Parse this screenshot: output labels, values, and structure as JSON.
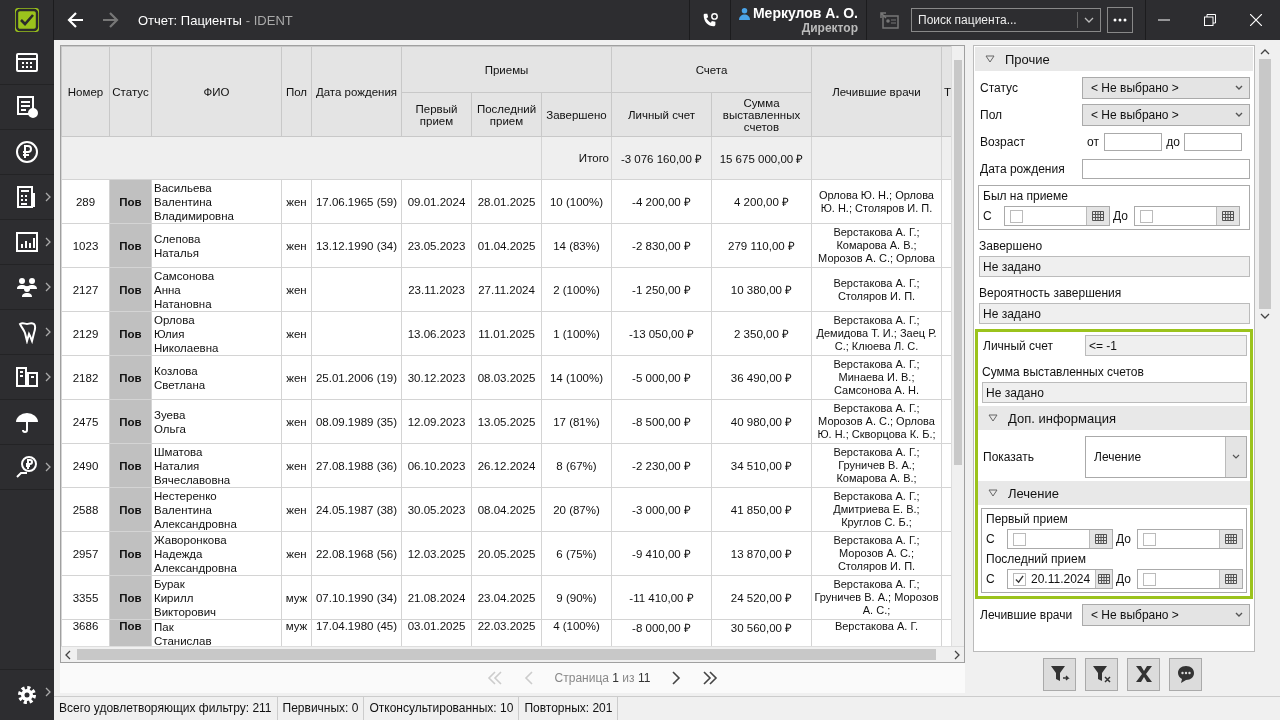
{
  "top_bar": {
    "title": "Отчет: Пациенты",
    "app": "- IDENT",
    "back_disabled": false,
    "forward_disabled": true,
    "user": "Меркулов А. О.",
    "role": "Директор",
    "card_disabled": true,
    "search": {
      "placeholder": "Поиск пациента..."
    }
  },
  "sidebar": {
    "items": [
      {
        "kind": "calendar",
        "submenu": false
      },
      {
        "kind": "document",
        "submenu": false
      },
      {
        "kind": "ruble",
        "submenu": false
      },
      {
        "kind": "calculator",
        "submenu": true
      },
      {
        "kind": "chart",
        "submenu": true
      },
      {
        "kind": "people",
        "submenu": true
      },
      {
        "kind": "tooth",
        "submenu": true
      },
      {
        "kind": "devices",
        "submenu": true
      },
      {
        "kind": "umbrella",
        "submenu": false
      },
      {
        "kind": "ruble-hand",
        "submenu": true
      }
    ],
    "settings": {
      "submenu": true
    }
  },
  "table": {
    "header": [
      {
        "label": "Номер"
      },
      {
        "label": "Статус"
      },
      {
        "label": "ФИО"
      },
      {
        "label": "Пол"
      },
      {
        "label": "Дата рождения"
      },
      {
        "group": "Приемы",
        "columns": [
          "Первый прием",
          "Последний прием",
          "Завершено"
        ]
      },
      {
        "group": "Счета",
        "columns": [
          "Личный счет",
          "Сумма выставленных счетов"
        ]
      },
      {
        "label": "Лечившие врачи"
      },
      {
        "label": "Т"
      }
    ],
    "totals": {
      "label": "Итого",
      "personal": "-3 076 160,00 ₽",
      "invoices": "15 675 000,00 ₽"
    },
    "rows": [
      {
        "number": "289",
        "status": "Пов",
        "name": "Васильева Валентина Владимировна",
        "gender": "жен",
        "birth": "17.06.1965 (59)",
        "first": "09.01.2024",
        "last": "28.01.2025",
        "done": "10 (100%)",
        "personal": "-4 200,00 ₽",
        "invoices": "4 200,00 ₽",
        "doctors": "Орлова Ю. Н.; Орлова Ю. Н.; Столяров И. П."
      },
      {
        "number": "1023",
        "status": "Пов",
        "name": "Слепова Наталья",
        "gender": "жен",
        "birth": "13.12.1990 (34)",
        "first": "23.05.2023",
        "last": "01.04.2025",
        "done": "14 (83%)",
        "personal": "-2 830,00 ₽",
        "invoices": "279 110,00 ₽",
        "doctors": "Верстакова А. Г.; Комарова А. В.; Морозов А. С.; Орлова"
      },
      {
        "number": "2127",
        "status": "Пов",
        "name": "Самсонова Анна Натановна",
        "gender": "жен",
        "birth": "",
        "first": "23.11.2023",
        "last": "27.11.2024",
        "done": "2 (100%)",
        "personal": "-1 250,00 ₽",
        "invoices": "10 380,00 ₽",
        "doctors": "Верстакова А. Г.; Столяров И. П."
      },
      {
        "number": "2129",
        "status": "Пов",
        "name": "Орлова Юлия Николаевна",
        "gender": "жен",
        "birth": "",
        "first": "13.06.2023",
        "last": "11.01.2025",
        "done": "1 (100%)",
        "personal": "-13 050,00 ₽",
        "invoices": "2 350,00 ₽",
        "doctors": "Верстакова А. Г.; Демидова Т. И.; Заец Р. С.; Клюева Л. С."
      },
      {
        "number": "2182",
        "status": "Пов",
        "name": "Козлова Светлана",
        "gender": "жен",
        "birth": "25.01.2006 (19)",
        "first": "30.12.2023",
        "last": "08.03.2025",
        "done": "14 (100%)",
        "personal": "-5 000,00 ₽",
        "invoices": "36 490,00 ₽",
        "doctors": "Верстакова А. Г.; Минаева И. В.; Самсонова А. Н."
      },
      {
        "number": "2475",
        "status": "Пов",
        "name": "Зуева Ольга",
        "gender": "жен",
        "birth": "08.09.1989 (35)",
        "first": "12.09.2023",
        "last": "13.05.2025",
        "done": "17 (81%)",
        "personal": "-8 500,00 ₽",
        "invoices": "40 980,00 ₽",
        "doctors": "Верстакова А. Г.; Морозов А. С.; Орлова Ю. Н.; Скворцова К. Б.;"
      },
      {
        "number": "2490",
        "status": "Пов",
        "name": "Шматова Наталия Вячеславовна",
        "gender": "жен",
        "birth": "27.08.1988 (36)",
        "first": "06.10.2023",
        "last": "26.12.2024",
        "done": "8 (67%)",
        "personal": "-2 230,00 ₽",
        "invoices": "34 510,00 ₽",
        "doctors": "Верстакова А. Г.; Груничев В. А.; Комарова А. В.;"
      },
      {
        "number": "2588",
        "status": "Пов",
        "name": "Нестеренко Валентина Александровна",
        "gender": "жен",
        "birth": "24.05.1987 (38)",
        "first": "30.05.2023",
        "last": "08.04.2025",
        "done": "20 (87%)",
        "personal": "-3 000,00 ₽",
        "invoices": "41 850,00 ₽",
        "doctors": "Верстакова А. Г.; Дмитриева Е. В.; Круглов С. Б.;"
      },
      {
        "number": "2957",
        "status": "Пов",
        "name": "Жаворонкова Надежда Александровна",
        "gender": "жен",
        "birth": "22.08.1968 (56)",
        "first": "12.03.2025",
        "last": "20.05.2025",
        "done": "6 (75%)",
        "personal": "-9 410,00 ₽",
        "invoices": "13 870,00 ₽",
        "doctors": "Верстакова А. Г.; Морозов А. С.; Столяров И. П."
      },
      {
        "number": "3355",
        "status": "Пов",
        "name": "Бурак Кирилл Викторович",
        "gender": "муж",
        "birth": "07.10.1990 (34)",
        "first": "21.08.2024",
        "last": "23.04.2025",
        "done": "9 (90%)",
        "personal": "-11 410,00 ₽",
        "invoices": "24 520,00 ₽",
        "doctors": "Верстакова А. Г.; Груничев В. А.; Морозов А. С.;"
      },
      {
        "number": "3686",
        "status": "Пов",
        "name": "Пак Станислав",
        "gender": "муж",
        "birth": "17.04.1980 (45)",
        "first": "03.01.2025",
        "last": "22.03.2025",
        "done": "4 (100%)",
        "personal": "-8 000,00 ₽",
        "invoices": "30 560,00 ₽",
        "doctors": "Верстакова А. Г."
      }
    ]
  },
  "pager": {
    "text": "Страница **1** из **11**",
    "first_disabled": true,
    "prev_disabled": true,
    "next_disabled": false,
    "last_disabled": false
  },
  "filters": {
    "other": {
      "title": "Прочие",
      "expanded": true,
      "status": {
        "label": "Статус",
        "value": "< Не выбрано >"
      },
      "gender": {
        "label": "Пол",
        "value": "< Не выбрано >"
      },
      "age": {
        "label": "Возраст",
        "from": "от",
        "to": "до"
      },
      "birth": {
        "label": "Дата рождения"
      },
      "visited": {
        "label": "Был на приеме",
        "from": "С",
        "to": "До",
        "from_checked": false,
        "to_checked": false
      },
      "completed": {
        "label": "Завершено",
        "value": "Не задано"
      },
      "probability": {
        "label": "Вероятность завершения",
        "value": "Не задано"
      },
      "personal": {
        "label": "Личный счет",
        "value": "<= -1"
      },
      "invoices": {
        "label": "Сумма выставленных счетов",
        "value": "Не задано"
      }
    },
    "highlighted": true,
    "extra": {
      "title": "Доп. информация",
      "expanded": true,
      "show": {
        "label": "Показать",
        "value": "Лечение"
      }
    },
    "treatment": {
      "title": "Лечение",
      "expanded": true,
      "first": {
        "label": "Первый прием",
        "from": "С",
        "to": "До",
        "from_checked": false,
        "to_checked": false
      },
      "last": {
        "label": "Последний прием",
        "from": "С",
        "to": "До",
        "from_checked": true,
        "from_value": "20.11.2024",
        "to_checked": false
      }
    },
    "doctors": {
      "label": "Лечившие врачи",
      "value": "< Не выбрано >"
    }
  },
  "actions": [
    {
      "kind": "filter-add"
    },
    {
      "kind": "filter-clear"
    },
    {
      "kind": "excel"
    },
    {
      "kind": "chat"
    }
  ],
  "status_bar": [
    "Всего удовлетворяющих фильтру: 211",
    "Первичных: 0",
    "Отконсультированных: 10",
    "Повторных: 201"
  ]
}
